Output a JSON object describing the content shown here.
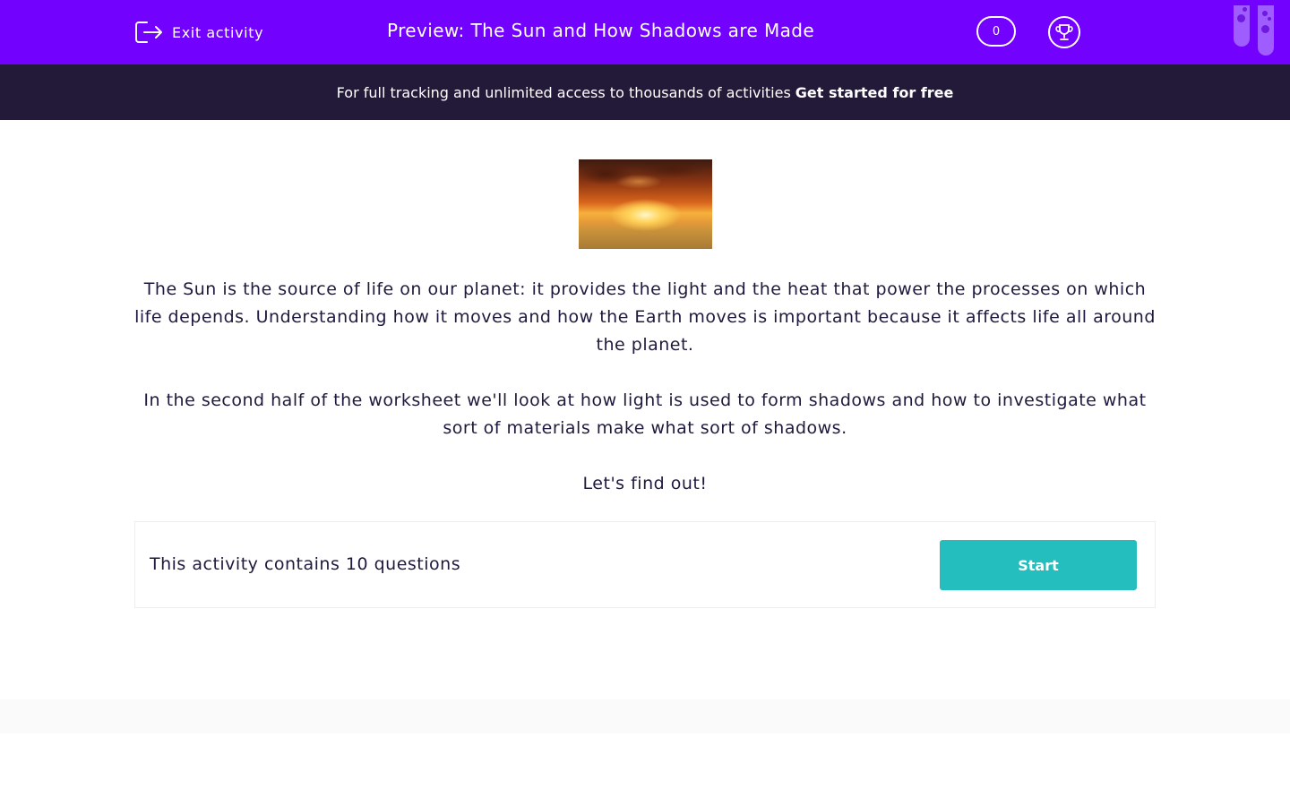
{
  "header": {
    "exit_label": "Exit activity",
    "title": "Preview: The Sun and How Shadows are Made",
    "score": "0",
    "brand_color": "#7301fe",
    "icons": [
      "exit-icon",
      "trophy-icon",
      "test-tube-icon"
    ]
  },
  "banner": {
    "text": "For full tracking and unlimited access to thousands of activities",
    "cta": "Get started for free"
  },
  "intro": {
    "image": "sunset-over-water-photo",
    "paragraphs": [
      "The Sun is the source of life on our planet: it provides the light and the heat that power the processes on which life depends. Understanding how it moves and how the Earth moves is important because it affects life all around the planet.",
      "In the second half of the worksheet we'll look at how light is used to form shadows and how to investigate what sort of materials make what sort of shadows.",
      "Let's find out!"
    ]
  },
  "activity": {
    "summary": "This activity contains 10 questions",
    "start_label": "Start",
    "button_color": "#24bebf"
  }
}
